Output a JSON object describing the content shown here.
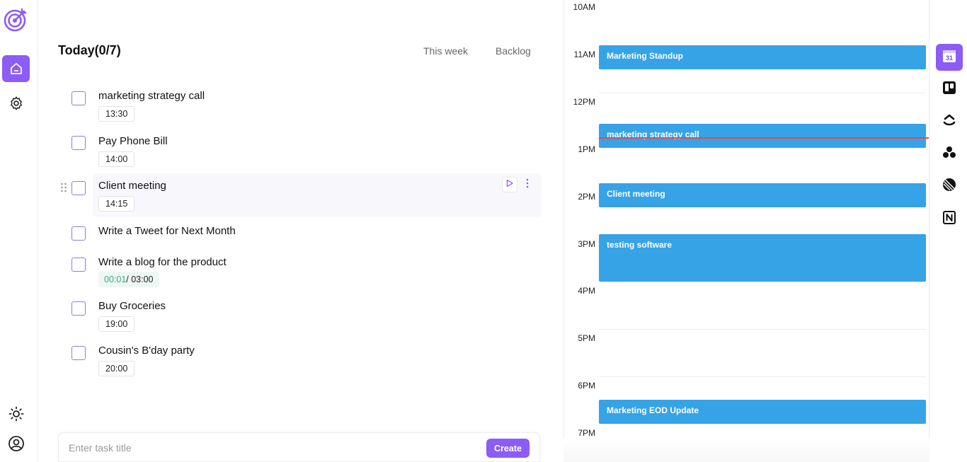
{
  "colors": {
    "accent": "#8b5cf6",
    "event": "#36a3e6",
    "now_line": "#e5484d",
    "timer_elapsed": "#3aa88a"
  },
  "sidebar": {
    "logo_icon": "target-arrow-icon",
    "items": [
      {
        "icon": "home-icon",
        "active": true
      },
      {
        "icon": "gear-icon",
        "active": false
      }
    ],
    "bottom": [
      {
        "icon": "sun-icon"
      },
      {
        "icon": "user-circle-icon"
      }
    ]
  },
  "header": {
    "title": "Today(0/7)",
    "tabs": [
      {
        "label": "This week"
      },
      {
        "label": "Backlog"
      }
    ]
  },
  "tasks": [
    {
      "title": "marketing strategy call",
      "time": "13:30"
    },
    {
      "title": "Pay Phone Bill",
      "time": "14:00"
    },
    {
      "title": "Client meeting",
      "time": "14:15",
      "hovered": true
    },
    {
      "title": "Write a Tweet for Next Month"
    },
    {
      "title": "Write a blog for the product",
      "timer_elapsed": "00:01",
      "timer_total": "/ 03:00"
    },
    {
      "title": "Buy Groceries",
      "time": "19:00"
    },
    {
      "title": "Cousin's B'day party",
      "time": "20:00"
    }
  ],
  "new_task": {
    "placeholder": "Enter task title",
    "value": "",
    "create_label": "Create"
  },
  "calendar": {
    "hours": [
      "10AM",
      "11AM",
      "12PM",
      "1PM",
      "2PM",
      "3PM",
      "4PM",
      "5PM",
      "6PM",
      "7PM"
    ],
    "events": [
      {
        "title": "Marketing Standup",
        "start": "11:00",
        "end": "11:30"
      },
      {
        "title": "marketing strategy call",
        "start": "12:30",
        "end": "13:00"
      },
      {
        "title": "Client meeting",
        "start": "14:00",
        "end": "14:30"
      },
      {
        "title": "testing software",
        "start": "15:00",
        "end": "16:00"
      },
      {
        "title": "Marketing EOD Update",
        "start": "18:15",
        "end": "18:45"
      }
    ],
    "current_time": "12:47"
  },
  "integrations": [
    {
      "icon": "google-calendar-icon",
      "active": true
    },
    {
      "icon": "trello-icon"
    },
    {
      "icon": "clickup-icon"
    },
    {
      "icon": "asana-icon"
    },
    {
      "icon": "linear-icon"
    },
    {
      "icon": "notion-icon"
    }
  ]
}
